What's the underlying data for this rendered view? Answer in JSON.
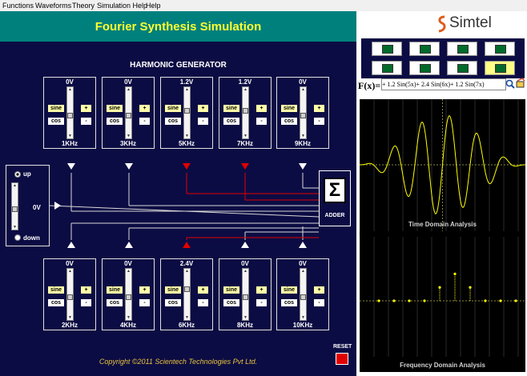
{
  "menu": [
    "Functions",
    "Waveforms",
    "Theory",
    "Simulation Help",
    "Help"
  ],
  "app": {
    "title": "Fourier Synthesis Simulation",
    "section": "HARMONIC GENERATOR",
    "copyright": "Copyright ©2011 Scientech Technologies Pvt Ltd.",
    "reset": "RESET",
    "adder": "ADDER",
    "sigma": "Σ"
  },
  "buttons": {
    "sine": "sine",
    "cos": "cos",
    "plus": "+",
    "minus": "-"
  },
  "harmonics_top": [
    {
      "voltage": "0V",
      "freq": "1KHz",
      "level": 0.5
    },
    {
      "voltage": "0V",
      "freq": "3KHz",
      "level": 0.5
    },
    {
      "voltage": "1.2V",
      "freq": "5KHz",
      "level": 0.62
    },
    {
      "voltage": "1.2V",
      "freq": "7KHz",
      "level": 0.62
    },
    {
      "voltage": "0V",
      "freq": "9KHz",
      "level": 0.5
    }
  ],
  "harmonics_bottom": [
    {
      "voltage": "0V",
      "freq": "2KHz",
      "level": 0.5
    },
    {
      "voltage": "0V",
      "freq": "4KHz",
      "level": 0.5
    },
    {
      "voltage": "2.4V",
      "freq": "6KHz",
      "level": 0.7
    },
    {
      "voltage": "0V",
      "freq": "8KHz",
      "level": 0.5
    },
    {
      "voltage": "0V",
      "freq": "10KHz",
      "level": 0.5
    }
  ],
  "dc": {
    "up": "up",
    "down": "down",
    "voltage": "0V",
    "level": 0.5
  },
  "brand": "Simtel",
  "formula": {
    "label": "F(x)=",
    "value": "+ 1.2 Sin(5x)+ 2.4 Sin(6x)+ 1.2 Sin(7x)"
  },
  "waveform_buttons": [
    "sine",
    "square",
    "triangle",
    "pulse",
    "sawtooth",
    "full-rectified",
    "half-rectified",
    "custom"
  ],
  "active_waveform": 7,
  "scopes": {
    "time": "Time Domain Analysis",
    "freq": "Frequency Domain Analysis"
  },
  "colors": {
    "panel": "#0c0c44",
    "title_bar": "#00807c",
    "title_text": "#ffff33",
    "active_line": "#e00000",
    "trace": "#ffff00"
  }
}
